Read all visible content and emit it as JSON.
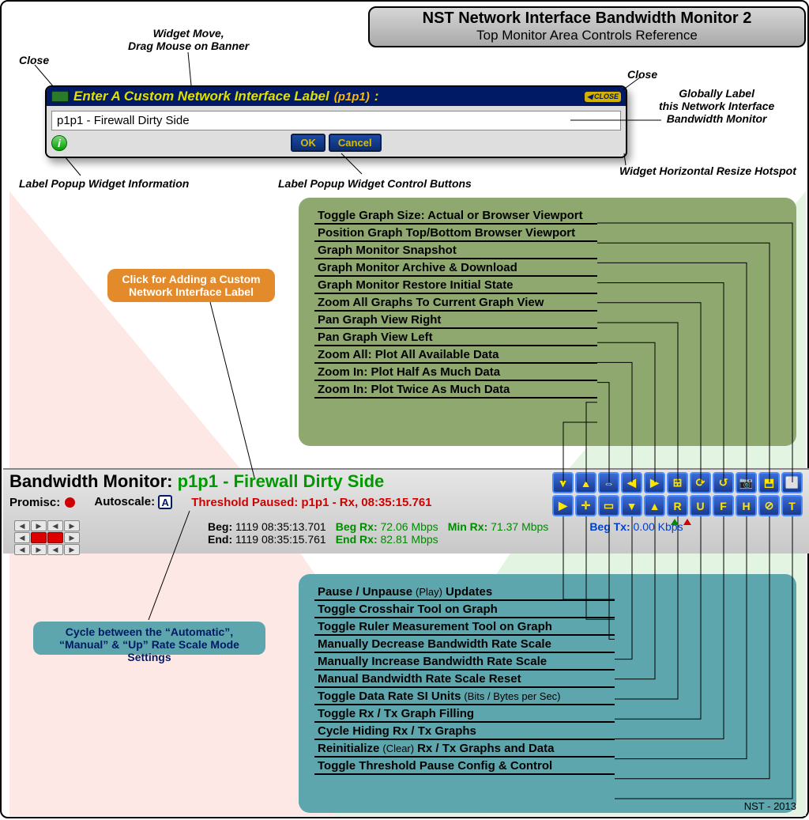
{
  "header": {
    "title": "NST Network Interface Bandwidth Monitor 2",
    "subtitle": "Top Monitor Area Controls Reference"
  },
  "callouts": {
    "close_left": "Close",
    "move_banner": "Widget Move,\nDrag Mouse on Banner",
    "close_right": "Close",
    "globally_label": "Globally Label\nthis Network Interface\nBandwidth Monitor",
    "resize_hotspot": "Widget Horizontal Resize Hotspot",
    "label_popup_info": "Label Popup Widget Information",
    "label_popup_buttons": "Label Popup Widget Control Buttons"
  },
  "popup": {
    "title_prefix": "Enter A Custom Network Interface Label ",
    "iface": "(p1p1)",
    "colon": ":",
    "input_value": "p1p1 - Firewall Dirty Side",
    "ok": "OK",
    "cancel": "Cancel",
    "close": "CLOSE"
  },
  "green_items": [
    "Toggle Graph Size: Actual or Browser Viewport",
    "Position Graph Top/Bottom Browser Viewport",
    "Graph Monitor Snapshot",
    "Graph Monitor Archive & Download",
    "Graph Monitor Restore Initial State",
    "Zoom All Graphs To Current Graph View",
    "Pan Graph View Right",
    "Pan Graph View Left",
    "Zoom All: Plot All Available Data",
    "Zoom In: Plot Half As Much Data",
    "Zoom In: Plot Twice As Much Data"
  ],
  "teal_items": [
    {
      "main": "Pause / Unpause ",
      "sub": "(Play)",
      "tail": " Updates"
    },
    {
      "main": "Toggle Crosshair Tool on Graph"
    },
    {
      "main": "Toggle Ruler Measurement Tool on Graph"
    },
    {
      "main": "Manually Decrease Bandwidth Rate Scale"
    },
    {
      "main": "Manually Increase Bandwidth Rate Scale"
    },
    {
      "main": "Manual Bandwidth Rate Scale Reset"
    },
    {
      "main": "Toggle Data Rate SI Units ",
      "sub": "(Bits / Bytes per Sec)"
    },
    {
      "main": "Toggle Rx / Tx Graph Filling"
    },
    {
      "main": "Cycle Hiding Rx / Tx Graphs"
    },
    {
      "main": "Reinitialize ",
      "sub": "(Clear)",
      "tail": " Rx / Tx Graphs and Data"
    },
    {
      "main": "Toggle Threshold Pause Config & Control"
    }
  ],
  "orange_note": "Click for Adding a Custom Network Interface Label",
  "blue_note": "Cycle between the “Automatic”, “Manual” & “Up” Rate Scale Mode Settings",
  "monitor": {
    "title_prefix": "Bandwidth Monitor: ",
    "title_label": "p1p1 - Firewall Dirty Side",
    "promisc": "Promisc:",
    "autoscale": "Autoscale:",
    "autoscale_badge": "A",
    "threshold": "Threshold Paused: p1p1 - Rx, 08:35:15.761",
    "beg_label": "Beg:",
    "beg_val": "1119 08:35:13.701",
    "end_label": "End:",
    "end_val": "1119 08:35:15.761",
    "beg_rx_label": "Beg Rx:",
    "beg_rx_val": "72.06 Mbps",
    "end_rx_label": "End Rx:",
    "end_rx_val": "82.81 Mbps",
    "min_rx_label": "Min Rx:",
    "min_rx_val": "71.37 Mbps",
    "beg_tx_label": "Beg Tx:",
    "beg_tx_val": "0.00 Kbps"
  },
  "toolbar_top": [
    "▼",
    "▲",
    "⇔",
    "◀",
    "▶",
    "⊞",
    "⟳",
    "↺",
    "📷",
    "⬒",
    "⬜"
  ],
  "toolbar_bot": [
    "▶",
    "✛",
    "▭",
    "▼",
    "▲",
    "R",
    "U",
    "F",
    "H",
    "⊘",
    "T"
  ],
  "footer": "NST - 2013"
}
